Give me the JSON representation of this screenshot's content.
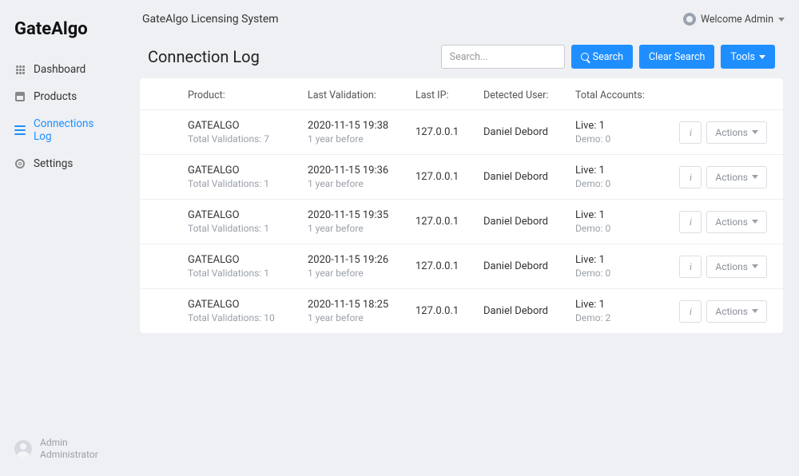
{
  "logo": "GateAlgo",
  "topbar": {
    "title": "GateAlgo Licensing System",
    "welcome": "Welcome Admin"
  },
  "sidebar": {
    "items": [
      {
        "label": "Dashboard"
      },
      {
        "label": "Products"
      },
      {
        "label": "Connections Log"
      },
      {
        "label": "Settings"
      }
    ]
  },
  "page": {
    "title": "Connection Log",
    "search_placeholder": "Search...",
    "search_button": "Search",
    "clear_button": "Clear Search",
    "tools_button": "Tools"
  },
  "table": {
    "headers": {
      "product": "Product:",
      "last_validation": "Last Validation:",
      "last_ip": "Last IP:",
      "detected_user": "Detected User:",
      "total_accounts": "Total Accounts:"
    },
    "validations_prefix": "Total Validations: ",
    "live_prefix": "Live: ",
    "demo_prefix": "Demo: ",
    "info_label": "i",
    "actions_label": "Actions",
    "rows": [
      {
        "product": "GATEALGO",
        "validations": "7",
        "ts": "2020-11-15 19:38",
        "ago": "1 year before",
        "ip": "127.0.0.1",
        "user": "Daniel Debord",
        "live": "1",
        "demo": "0"
      },
      {
        "product": "GATEALGO",
        "validations": "1",
        "ts": "2020-11-15 19:36",
        "ago": "1 year before",
        "ip": "127.0.0.1",
        "user": "Daniel Debord",
        "live": "1",
        "demo": "0"
      },
      {
        "product": "GATEALGO",
        "validations": "1",
        "ts": "2020-11-15 19:35",
        "ago": "1 year before",
        "ip": "127.0.0.1",
        "user": "Daniel Debord",
        "live": "1",
        "demo": "0"
      },
      {
        "product": "GATEALGO",
        "validations": "1",
        "ts": "2020-11-15 19:26",
        "ago": "1 year before",
        "ip": "127.0.0.1",
        "user": "Daniel Debord",
        "live": "1",
        "demo": "0"
      },
      {
        "product": "GATEALGO",
        "validations": "10",
        "ts": "2020-11-15 18:25",
        "ago": "1 year before",
        "ip": "127.0.0.1",
        "user": "Daniel Debord",
        "live": "1",
        "demo": "2"
      }
    ]
  },
  "footer": {
    "name": "Admin",
    "role": "Administrator"
  }
}
